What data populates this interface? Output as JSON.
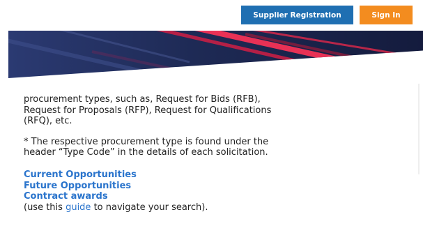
{
  "header": {
    "register_label": "Supplier Registration",
    "signin_label": "Sign In",
    "colors": {
      "register": "#1f6fb2",
      "signin": "#f38c1f"
    }
  },
  "banner": {
    "colors": {
      "base": "#1e2a55",
      "streak": "#e0294a"
    }
  },
  "content": {
    "para1": "procurement types, such as, Request for Bids (RFB), Request for Proposals (RFP), Request for Qualifications (RFQ), etc.",
    "para2": "* The respective procurement type is found under the header “Type Code” in the details of each solicitation.",
    "links": {
      "current": "Current Opportunities",
      "future": "Future Opportunities",
      "contract": "Contract awards"
    },
    "guide": {
      "before": "(use this ",
      "link": "guide",
      "after": " to navigate your search)."
    },
    "link_color": "#2a74cc"
  }
}
